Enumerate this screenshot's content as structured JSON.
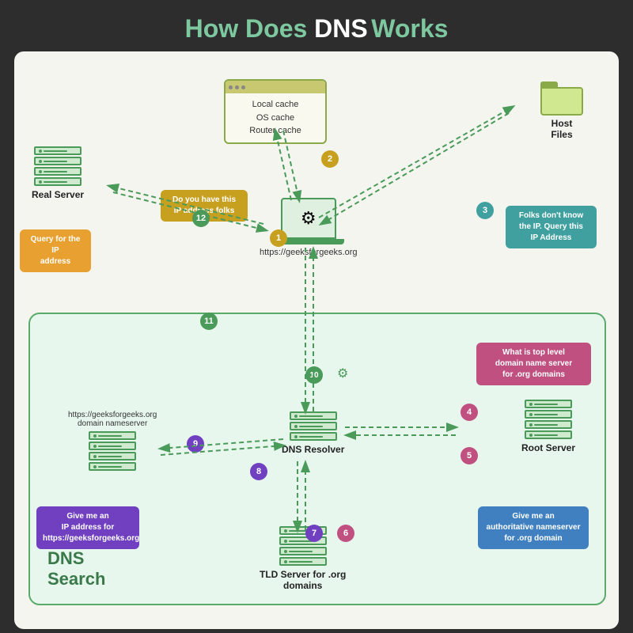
{
  "title": {
    "part1": "How Does ",
    "highlight": "DNS",
    "part2": " Works"
  },
  "cache_box": {
    "text": "Local cache\nOS cache\nRouter cache"
  },
  "host_files": {
    "label": "Host\nFiles"
  },
  "laptop": {
    "label": "https://geeksforgeeks.org"
  },
  "real_server": {
    "label": "Real Server",
    "query_tooltip": "Query for the IP\naddress"
  },
  "dns_search": {
    "label": "DNS\nSearch"
  },
  "tooltips": {
    "do_you_have": "Do you have this\nIP address folks",
    "folks_dont_know": "Folks don't know\nthe IP. Query this\nIP Address",
    "give_me_ip": "Give me an\nIP address for\nhttps://geeksforgeeks.org",
    "give_me_auth": "Give me an\nauthoritative nameserver\nfor .org domain",
    "what_is_top": "What is top level\ndomain name server\nfor .org domains"
  },
  "labels": {
    "dns_resolver": "DNS Resolver",
    "root_server": "Root Server",
    "tld_server": "TLD Server for .org\ndomains",
    "domain_ns": "https://geeksforgeeks.org\ndomain nameserver"
  },
  "numbers": [
    "1",
    "2",
    "3",
    "4",
    "5",
    "6",
    "7",
    "8",
    "9",
    "10",
    "11",
    "12"
  ],
  "colors": {
    "green_dark": "#4a9a5a",
    "green_light": "#8aaa4a",
    "orange": "#e8a030",
    "purple": "#7040c0",
    "blue": "#4080c0",
    "teal": "#40a0a0",
    "num_gold": "#c8a020",
    "num_pink": "#c05080",
    "num_green": "#4a9a5a",
    "num_purple": "#7040c0"
  }
}
